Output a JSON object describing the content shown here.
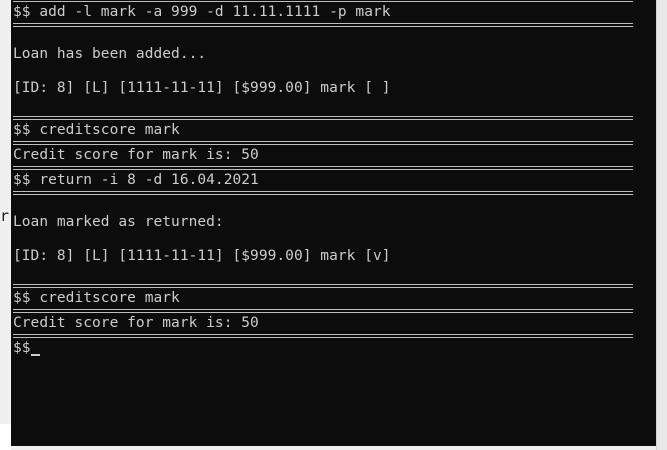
{
  "background": {
    "partial_char": "r"
  },
  "console": {
    "lines": [
      {
        "kind": "rule"
      },
      {
        "kind": "text",
        "text": "$$ add -l mark -a 999 -d 11.11.1111 -p mark"
      },
      {
        "kind": "rule"
      },
      {
        "kind": "blank"
      },
      {
        "kind": "text",
        "text": "Loan has been added..."
      },
      {
        "kind": "blank"
      },
      {
        "kind": "text",
        "text": "[ID: 8] [L] [1111-11-11] [$999.00] mark [ ]"
      },
      {
        "kind": "blank"
      },
      {
        "kind": "rule"
      },
      {
        "kind": "text",
        "text": "$$ creditscore mark"
      },
      {
        "kind": "rule"
      },
      {
        "kind": "text",
        "text": "Credit score for mark is: 50"
      },
      {
        "kind": "rule"
      },
      {
        "kind": "text",
        "text": "$$ return -i 8 -d 16.04.2021"
      },
      {
        "kind": "rule"
      },
      {
        "kind": "blank"
      },
      {
        "kind": "text",
        "text": "Loan marked as returned:"
      },
      {
        "kind": "blank"
      },
      {
        "kind": "text",
        "text": "[ID: 8] [L] [1111-11-11] [$999.00] mark [v]"
      },
      {
        "kind": "blank"
      },
      {
        "kind": "rule"
      },
      {
        "kind": "text",
        "text": "$$ creditscore mark"
      },
      {
        "kind": "rule"
      },
      {
        "kind": "text",
        "text": "Credit score for mark is: 50"
      },
      {
        "kind": "rule"
      },
      {
        "kind": "prompt",
        "text": "$$"
      }
    ],
    "colors": {
      "background": "#0c0c0c",
      "foreground": "#cccccc",
      "rule": "#bdbdbd"
    }
  }
}
